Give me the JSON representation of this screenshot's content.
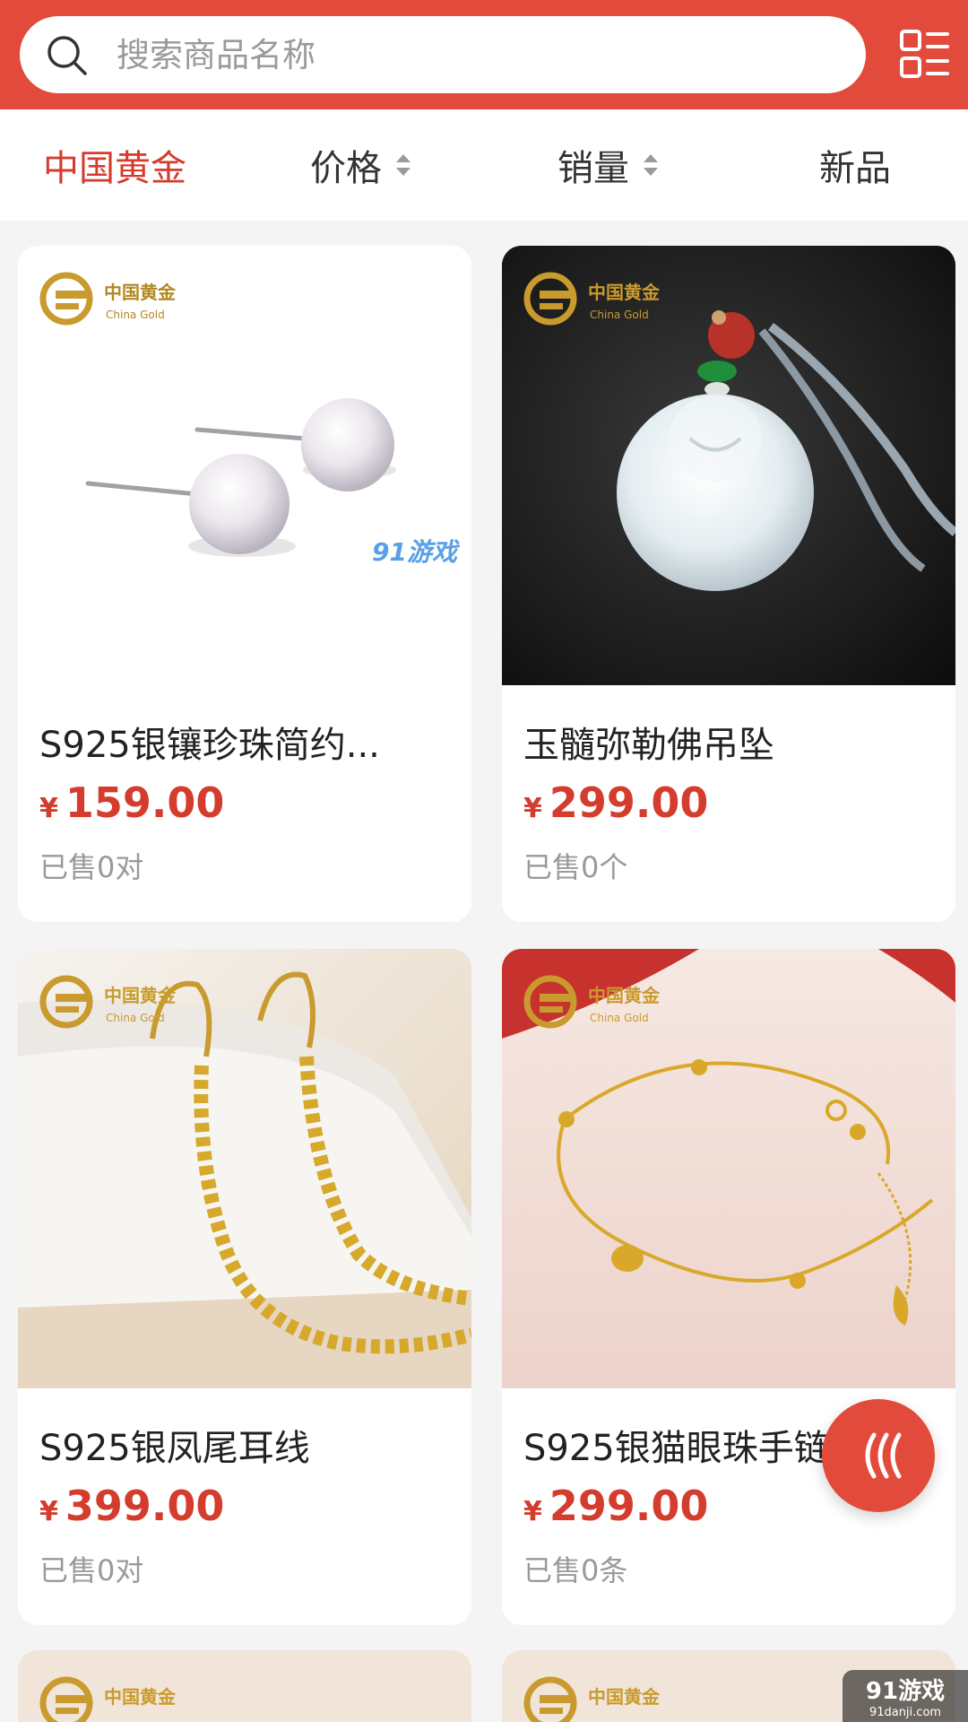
{
  "search": {
    "placeholder": "搜索商品名称"
  },
  "filters": [
    {
      "label": "中国黄金",
      "active": true
    },
    {
      "label": "价格"
    },
    {
      "label": "销量"
    },
    {
      "label": "新品"
    }
  ],
  "brand": {
    "name_cn": "中国黄金",
    "name_en": "China Gold"
  },
  "products": [
    {
      "title": "S925银镶珍珠简约...",
      "currency": "¥",
      "price": "159.00",
      "sold": "已售0对"
    },
    {
      "title": "玉髓弥勒佛吊坠",
      "currency": "¥",
      "price": "299.00",
      "sold": "已售0个"
    },
    {
      "title": "S925银凤尾耳线",
      "currency": "¥",
      "price": "399.00",
      "sold": "已售0对"
    },
    {
      "title": "S925银猫眼珠手链",
      "currency": "¥",
      "price": "299.00",
      "sold": "已售0条"
    }
  ],
  "watermark": {
    "text": "91游戏",
    "sub": "91danji.com"
  },
  "colors": {
    "accent": "#e24a3b",
    "price": "#d43c2e",
    "gold": "#c99a2e"
  }
}
